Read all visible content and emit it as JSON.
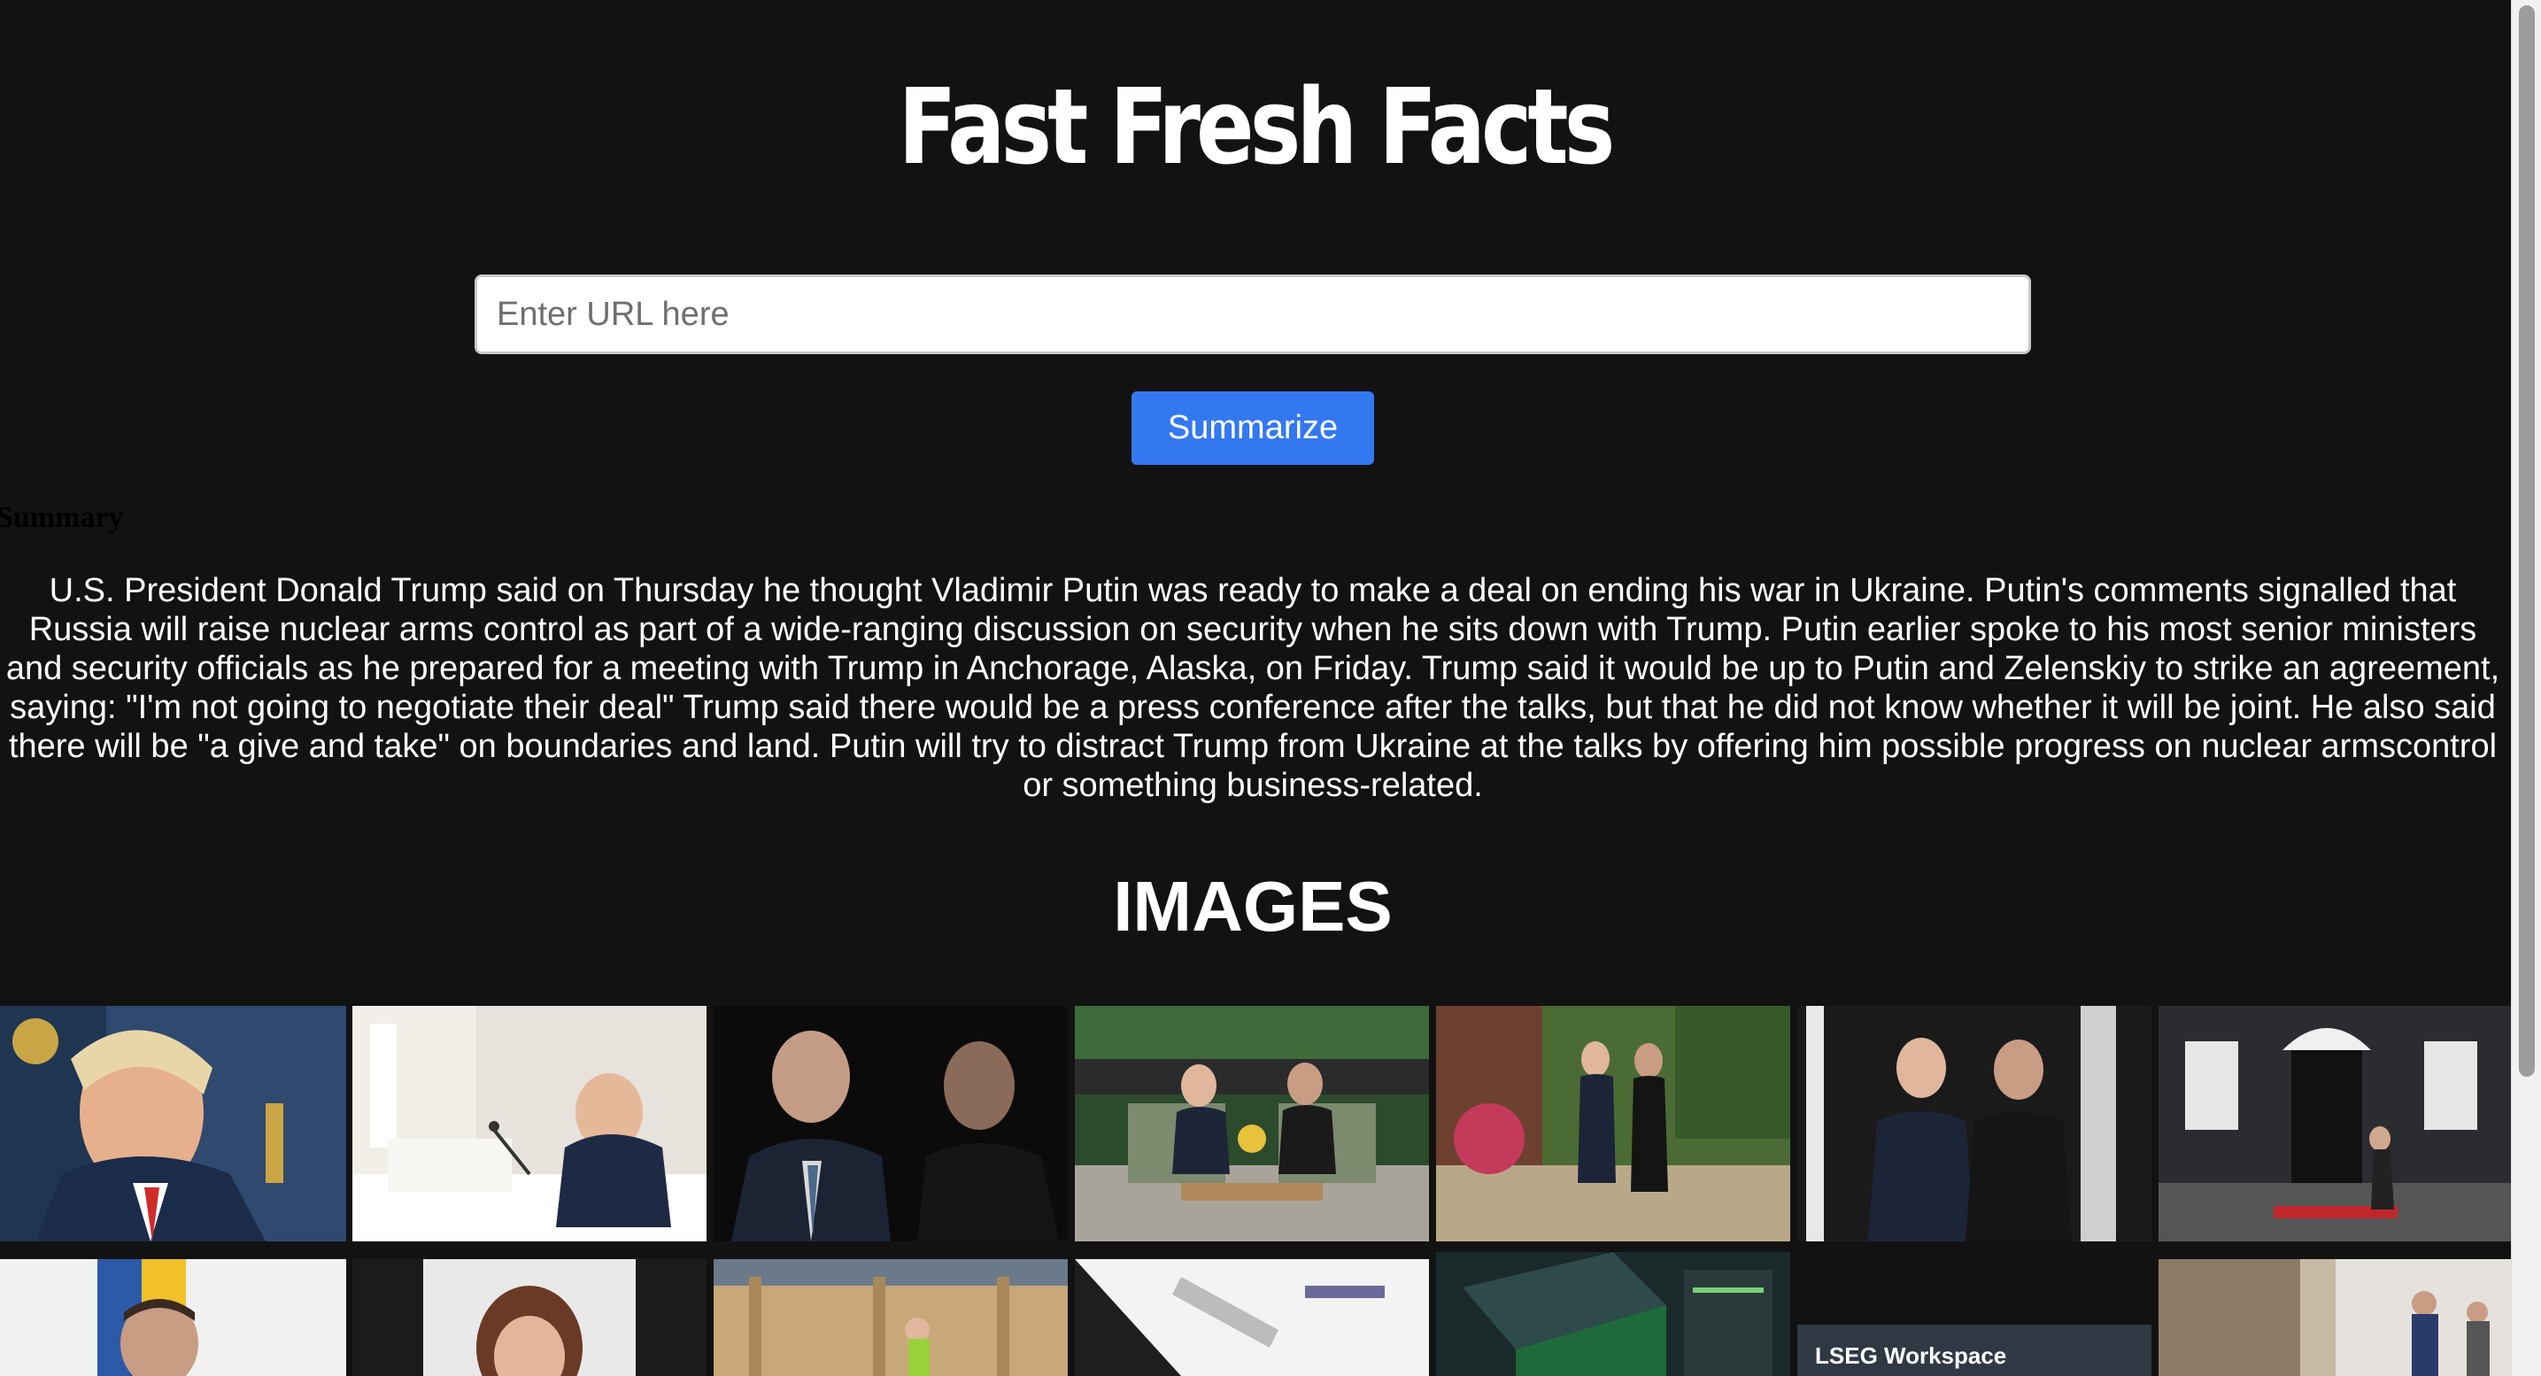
{
  "app": {
    "title": "Fast Fresh Facts"
  },
  "search": {
    "placeholder": "Enter URL here",
    "value": ""
  },
  "actions": {
    "summarize_label": "Summarize"
  },
  "summary": {
    "heading": "Summary",
    "text": "U.S. President Donald Trump said on Thursday he thought Vladimir Putin was ready to make a deal on ending his war in Ukraine. Putin's comments signalled that Russia will raise nuclear arms control as part of a wide-ranging discussion on security when he sits down with Trump. Putin earlier spoke to his most senior ministers and security officials as he prepared for a meeting with Trump in Anchorage, Alaska, on Friday. Trump said it would be up to Putin and Zelenskiy to strike an agreement, saying: \"I'm not going to negotiate their deal\" Trump said there would be a press conference after the talks, but that he did not know whether it will be joint. He also said there will be \"a give and take\" on boundaries and land. Putin will try to distract Trump from Ukraine at the talks by offering him possible progress on nuclear armscontrol or something business-related."
  },
  "images": {
    "heading": "IMAGES",
    "row2_caption": "LSEG Workspace"
  },
  "colors": {
    "background": "#121212",
    "accent": "#3478f0",
    "text": "#ffffff"
  }
}
